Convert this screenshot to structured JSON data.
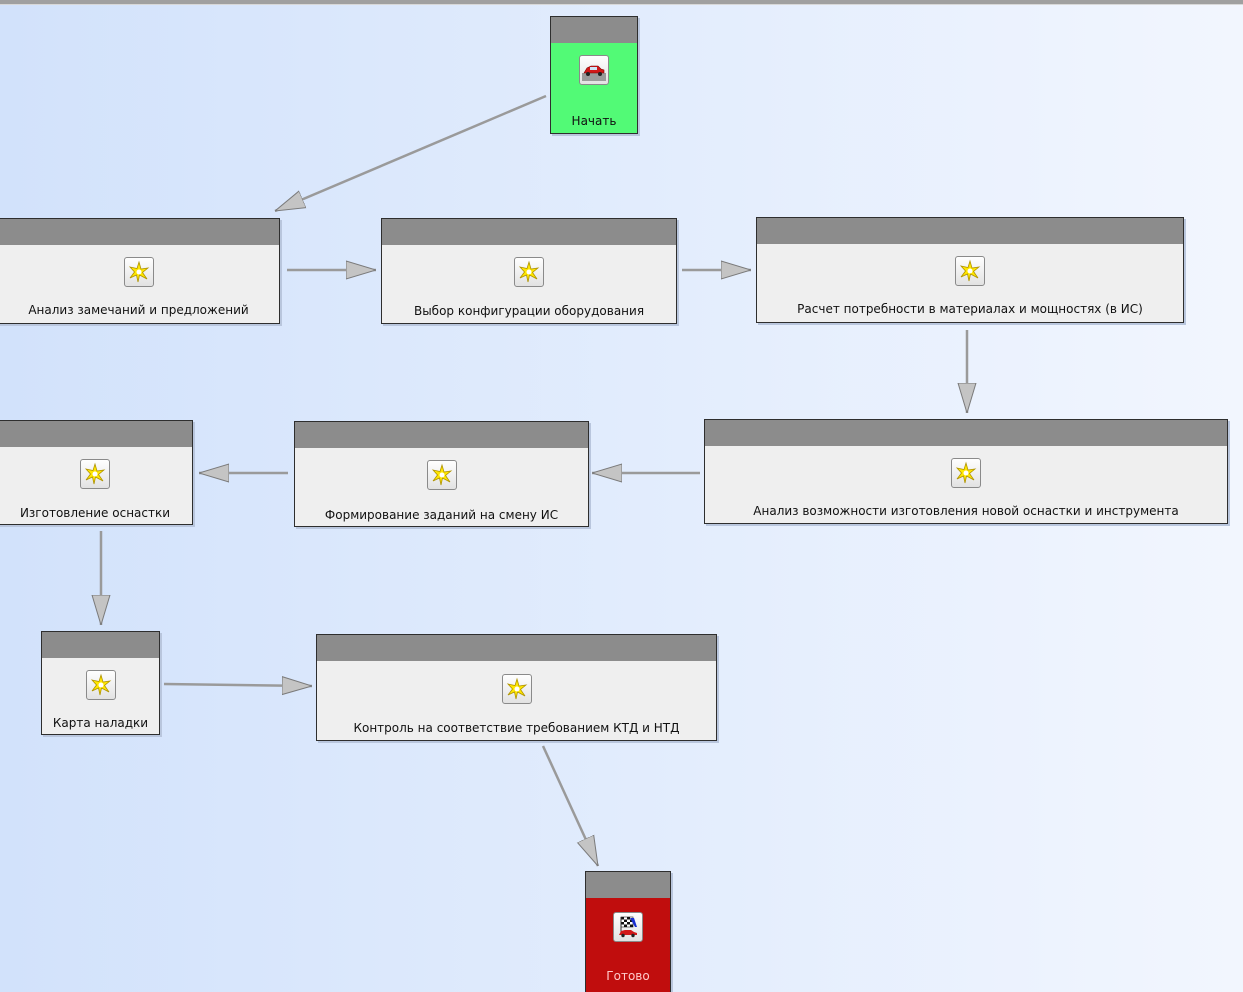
{
  "workflow": {
    "start_node": {
      "label": "Начать",
      "icon": "car-icon",
      "color": "#52fa76"
    },
    "end_node": {
      "label": "Готово",
      "icon": "race-flag-car-icon",
      "color": "#c00d0d"
    },
    "tasks": [
      {
        "label": "Анализ замечаний и предложений",
        "icon": "star-task-icon"
      },
      {
        "label": "Выбор конфигурации оборудования",
        "icon": "star-task-icon"
      },
      {
        "label": "Расчет потребности в материалах и мощностях (в ИС)",
        "icon": "star-task-icon"
      },
      {
        "label": "Анализ возможности изготовления новой оснастки и инструмента",
        "icon": "star-task-icon"
      },
      {
        "label": "Формирование заданий на смену ИС",
        "icon": "star-task-icon"
      },
      {
        "label": "Изготовление оснастки",
        "icon": "star-task-icon"
      },
      {
        "label": "Карта наладки",
        "icon": "star-task-icon"
      },
      {
        "label": "Контроль на соответствие требованием КТД и НТД",
        "icon": "star-task-icon"
      }
    ],
    "colors": {
      "header": "#8c8c8c",
      "body": "#efefef",
      "arrow": "#9a9a9a"
    }
  }
}
